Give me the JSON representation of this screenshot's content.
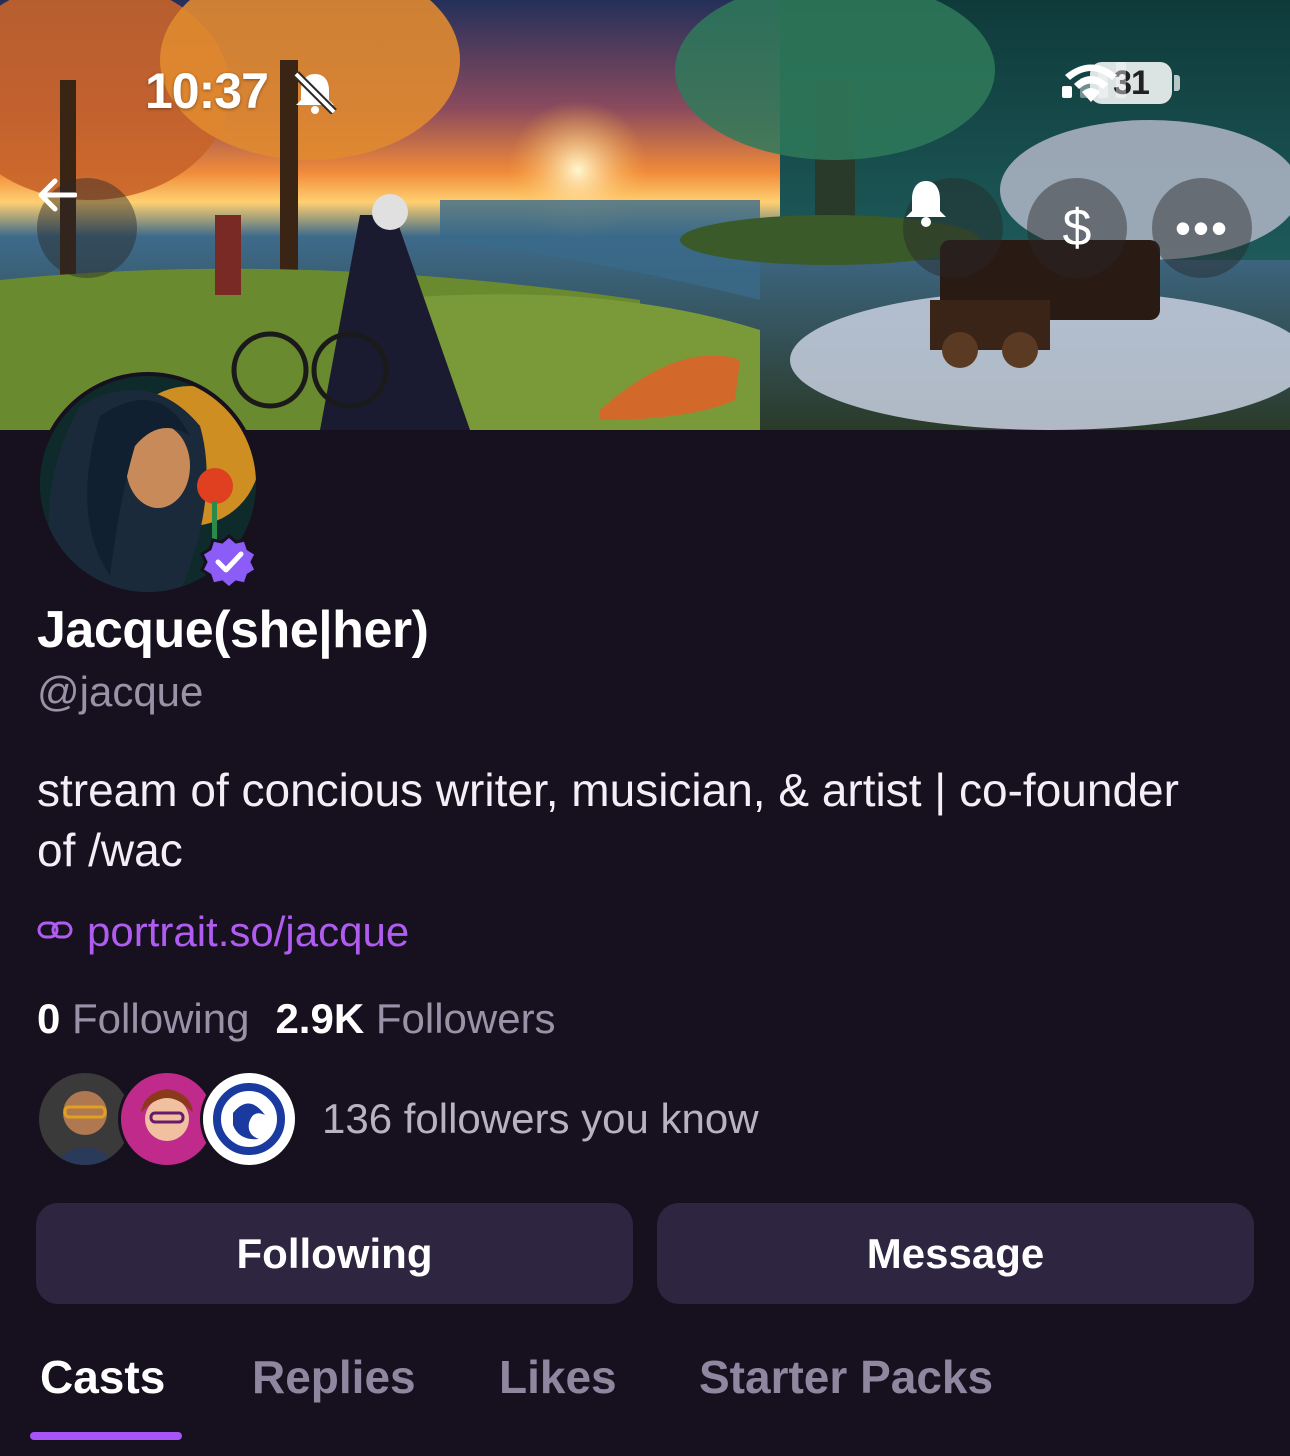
{
  "status_bar": {
    "time": "10:37",
    "battery": "31"
  },
  "header": {
    "back_icon": "arrow-left-icon",
    "actions": [
      "bell-icon",
      "dollar-icon",
      "more-icon"
    ],
    "tip_symbol": "$",
    "more_symbol": "•••"
  },
  "profile": {
    "display_name": "Jacque(she|her)",
    "handle": "@jacque",
    "verified": true,
    "bio": "stream of concious writer, musician, & artist | co-founder of /wac",
    "link": "portrait.so/jacque",
    "following_count": "0",
    "following_label": "Following",
    "followers_count": "2.9K",
    "followers_label": "Followers",
    "followers_you_know": "136 followers you know"
  },
  "buttons": {
    "following": "Following",
    "message": "Message"
  },
  "tabs": [
    {
      "label": "Casts",
      "active": true
    },
    {
      "label": "Replies",
      "active": false
    },
    {
      "label": "Likes",
      "active": false
    },
    {
      "label": "Starter Packs",
      "active": false
    }
  ],
  "colors": {
    "background": "#17101f",
    "accent": "#a855f7",
    "link": "#b05cf0",
    "button": "#2e2540",
    "verified": "#8b5cf6"
  }
}
